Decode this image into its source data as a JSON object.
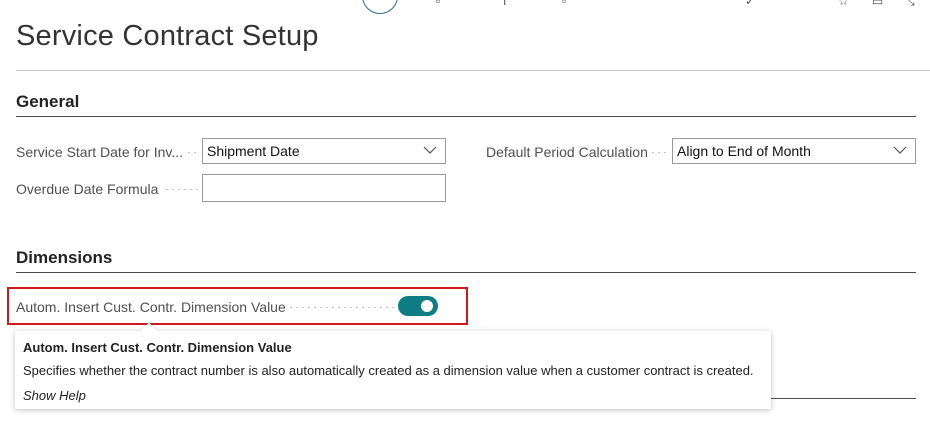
{
  "page": {
    "title": "Service Contract Setup"
  },
  "sections": {
    "general": {
      "title": "General"
    },
    "dimensions": {
      "title": "Dimensions"
    }
  },
  "fields": {
    "service_start_date": {
      "label": "Service Start Date for Inv...",
      "value": "Shipment Date"
    },
    "overdue_date_formula": {
      "label": "Overdue Date Formula",
      "value": ""
    },
    "default_period_calculation": {
      "label": "Default Period Calculation",
      "value": "Align to End of Month"
    },
    "autom_insert_dimension": {
      "label": "Autom. Insert Cust. Contr. Dimension Value",
      "value": true
    }
  },
  "tooltip": {
    "title": "Autom. Insert Cust. Contr. Dimension Value",
    "text": "Specifies whether the contract number is also automatically created as a dimension value when a customer contract is created.",
    "help_link": "Show Help"
  },
  "colors": {
    "toggle_on": "#0e7d86",
    "highlight": "#d0191e"
  }
}
